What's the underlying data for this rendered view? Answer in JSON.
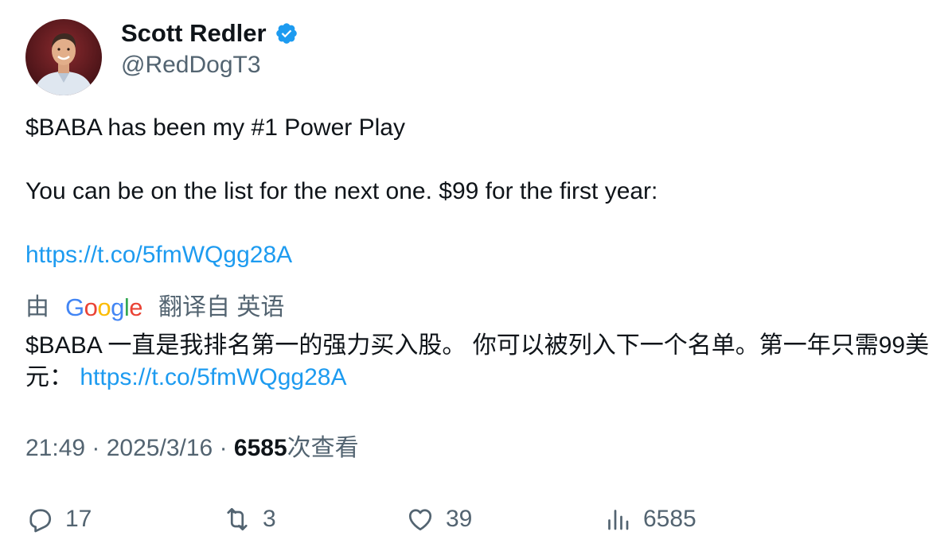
{
  "author": {
    "display_name": "Scott Redler",
    "handle": "@RedDogT3",
    "verified_icon": "verified-badge-icon",
    "accent_color": "#1d9bf0"
  },
  "tweet": {
    "line1": "$BABA has been my #1 Power Play",
    "line2": "You can be on the list for the next one. $99 for the first year:",
    "link": "https://t.co/5fmWQgg28A"
  },
  "translation": {
    "prefix": "由",
    "provider_letters": [
      "G",
      "o",
      "o",
      "g",
      "l",
      "e"
    ],
    "suffix": "翻译自 英语",
    "text": "$BABA 一直是我排名第一的强力买入股。 你可以被列入下一个名单。第一年只需99美元：",
    "link": "https://t.co/5fmWQgg28A"
  },
  "meta": {
    "time": "21:49",
    "separator": "·",
    "date": "2025/3/16",
    "views_count": "6585",
    "views_label": "次查看"
  },
  "actions": {
    "replies": "17",
    "retweets": "3",
    "likes": "39",
    "views": "6585"
  },
  "colors": {
    "text": "#0f1419",
    "secondary": "#536471",
    "link": "#1d9bf0"
  }
}
